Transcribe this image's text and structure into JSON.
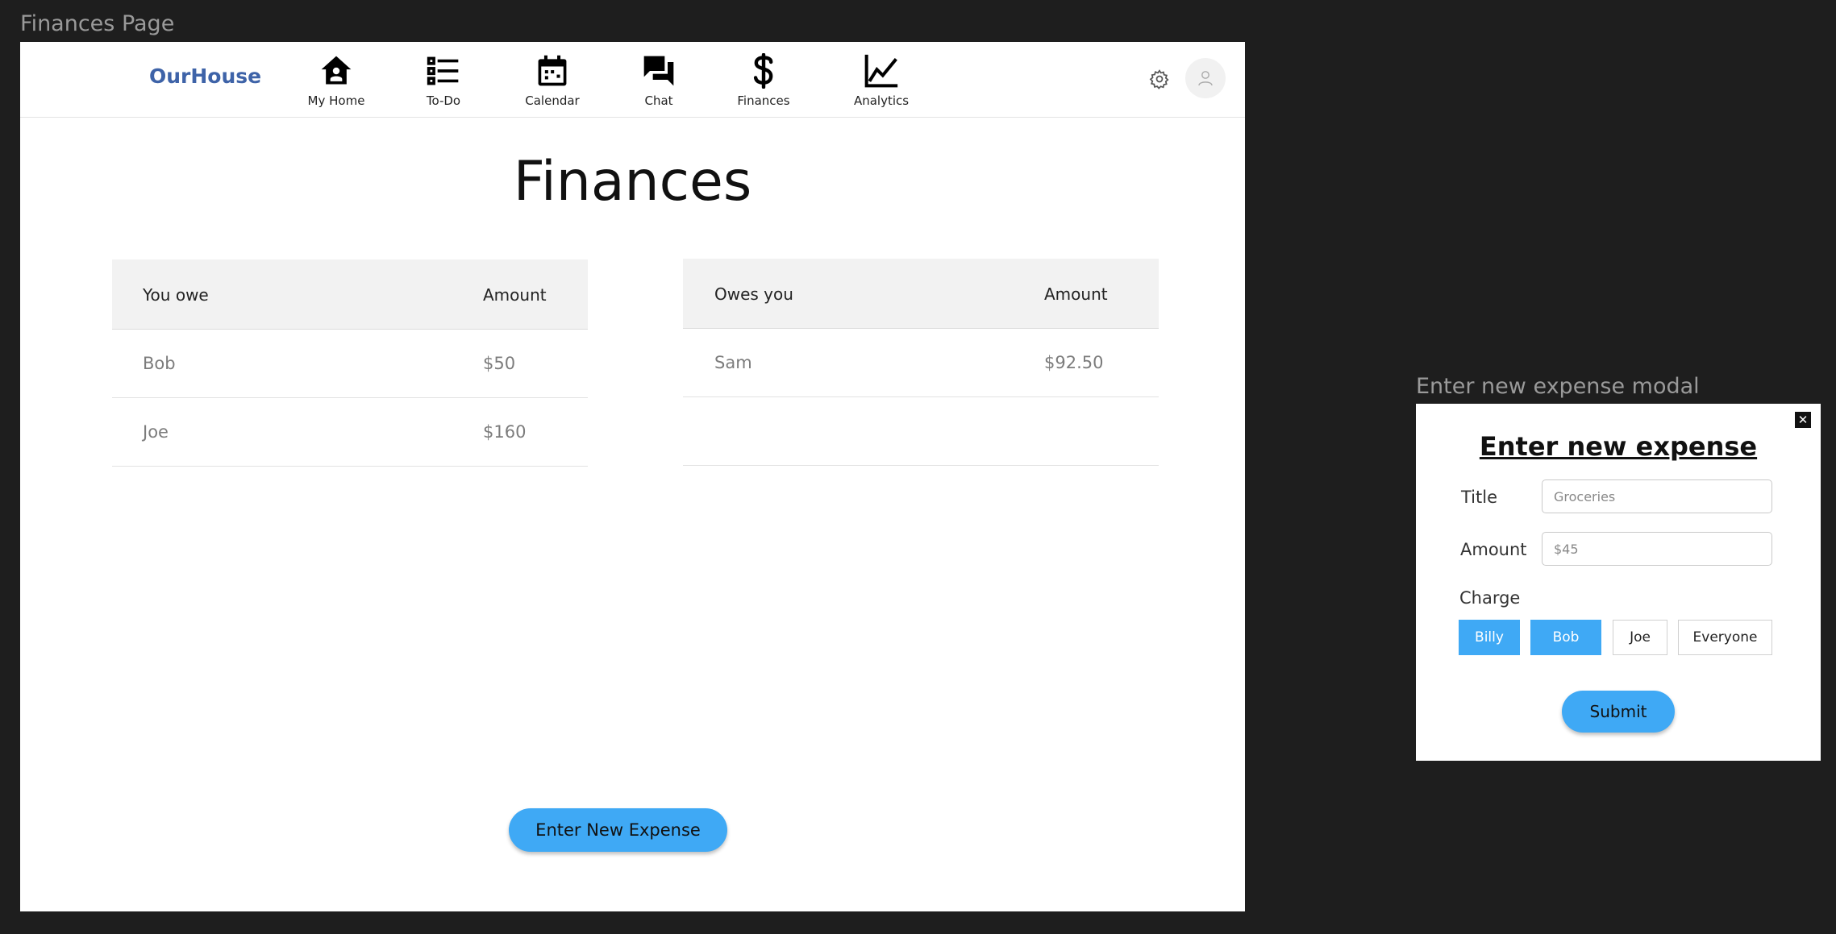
{
  "frames": {
    "main_label": "Finances Page",
    "modal_label": "Enter new expense modal"
  },
  "navbar": {
    "brand": "OurHouse",
    "items": [
      {
        "label": "My Home",
        "icon": "home-icon"
      },
      {
        "label": "To-Do",
        "icon": "list-icon"
      },
      {
        "label": "Calendar",
        "icon": "calendar-icon"
      },
      {
        "label": "Chat",
        "icon": "chat-icon"
      },
      {
        "label": "Finances",
        "icon": "dollar-icon"
      },
      {
        "label": "Analytics",
        "icon": "chart-icon"
      }
    ],
    "settings_icon": "gear-icon",
    "profile_icon": "user-icon"
  },
  "page": {
    "title": "Finances",
    "enter_expense_label": "Enter New Expense"
  },
  "you_owe": {
    "headers": [
      "You owe",
      "Amount"
    ],
    "rows": [
      {
        "name": "Bob",
        "amount": "$50"
      },
      {
        "name": "Joe",
        "amount": "$160"
      }
    ]
  },
  "owes_you": {
    "headers": [
      "Owes you",
      "Amount"
    ],
    "rows": [
      {
        "name": "Sam",
        "amount": "$92.50"
      },
      {
        "name": "",
        "amount": ""
      }
    ]
  },
  "modal": {
    "title": "Enter new expense",
    "close_icon": "close-icon",
    "title_field_label": "Title",
    "title_placeholder": "Groceries",
    "amount_field_label": "Amount",
    "amount_placeholder": "$45",
    "charge_label": "Charge",
    "charge_options": [
      {
        "label": "Billy",
        "selected": true
      },
      {
        "label": "Bob",
        "selected": true
      },
      {
        "label": "Joe",
        "selected": false
      },
      {
        "label": "Everyone",
        "selected": false
      }
    ],
    "submit_label": "Submit"
  },
  "colors": {
    "accent": "#3fa9f5",
    "brand": "#3e63a8",
    "canvas": "#1e1e1e"
  }
}
